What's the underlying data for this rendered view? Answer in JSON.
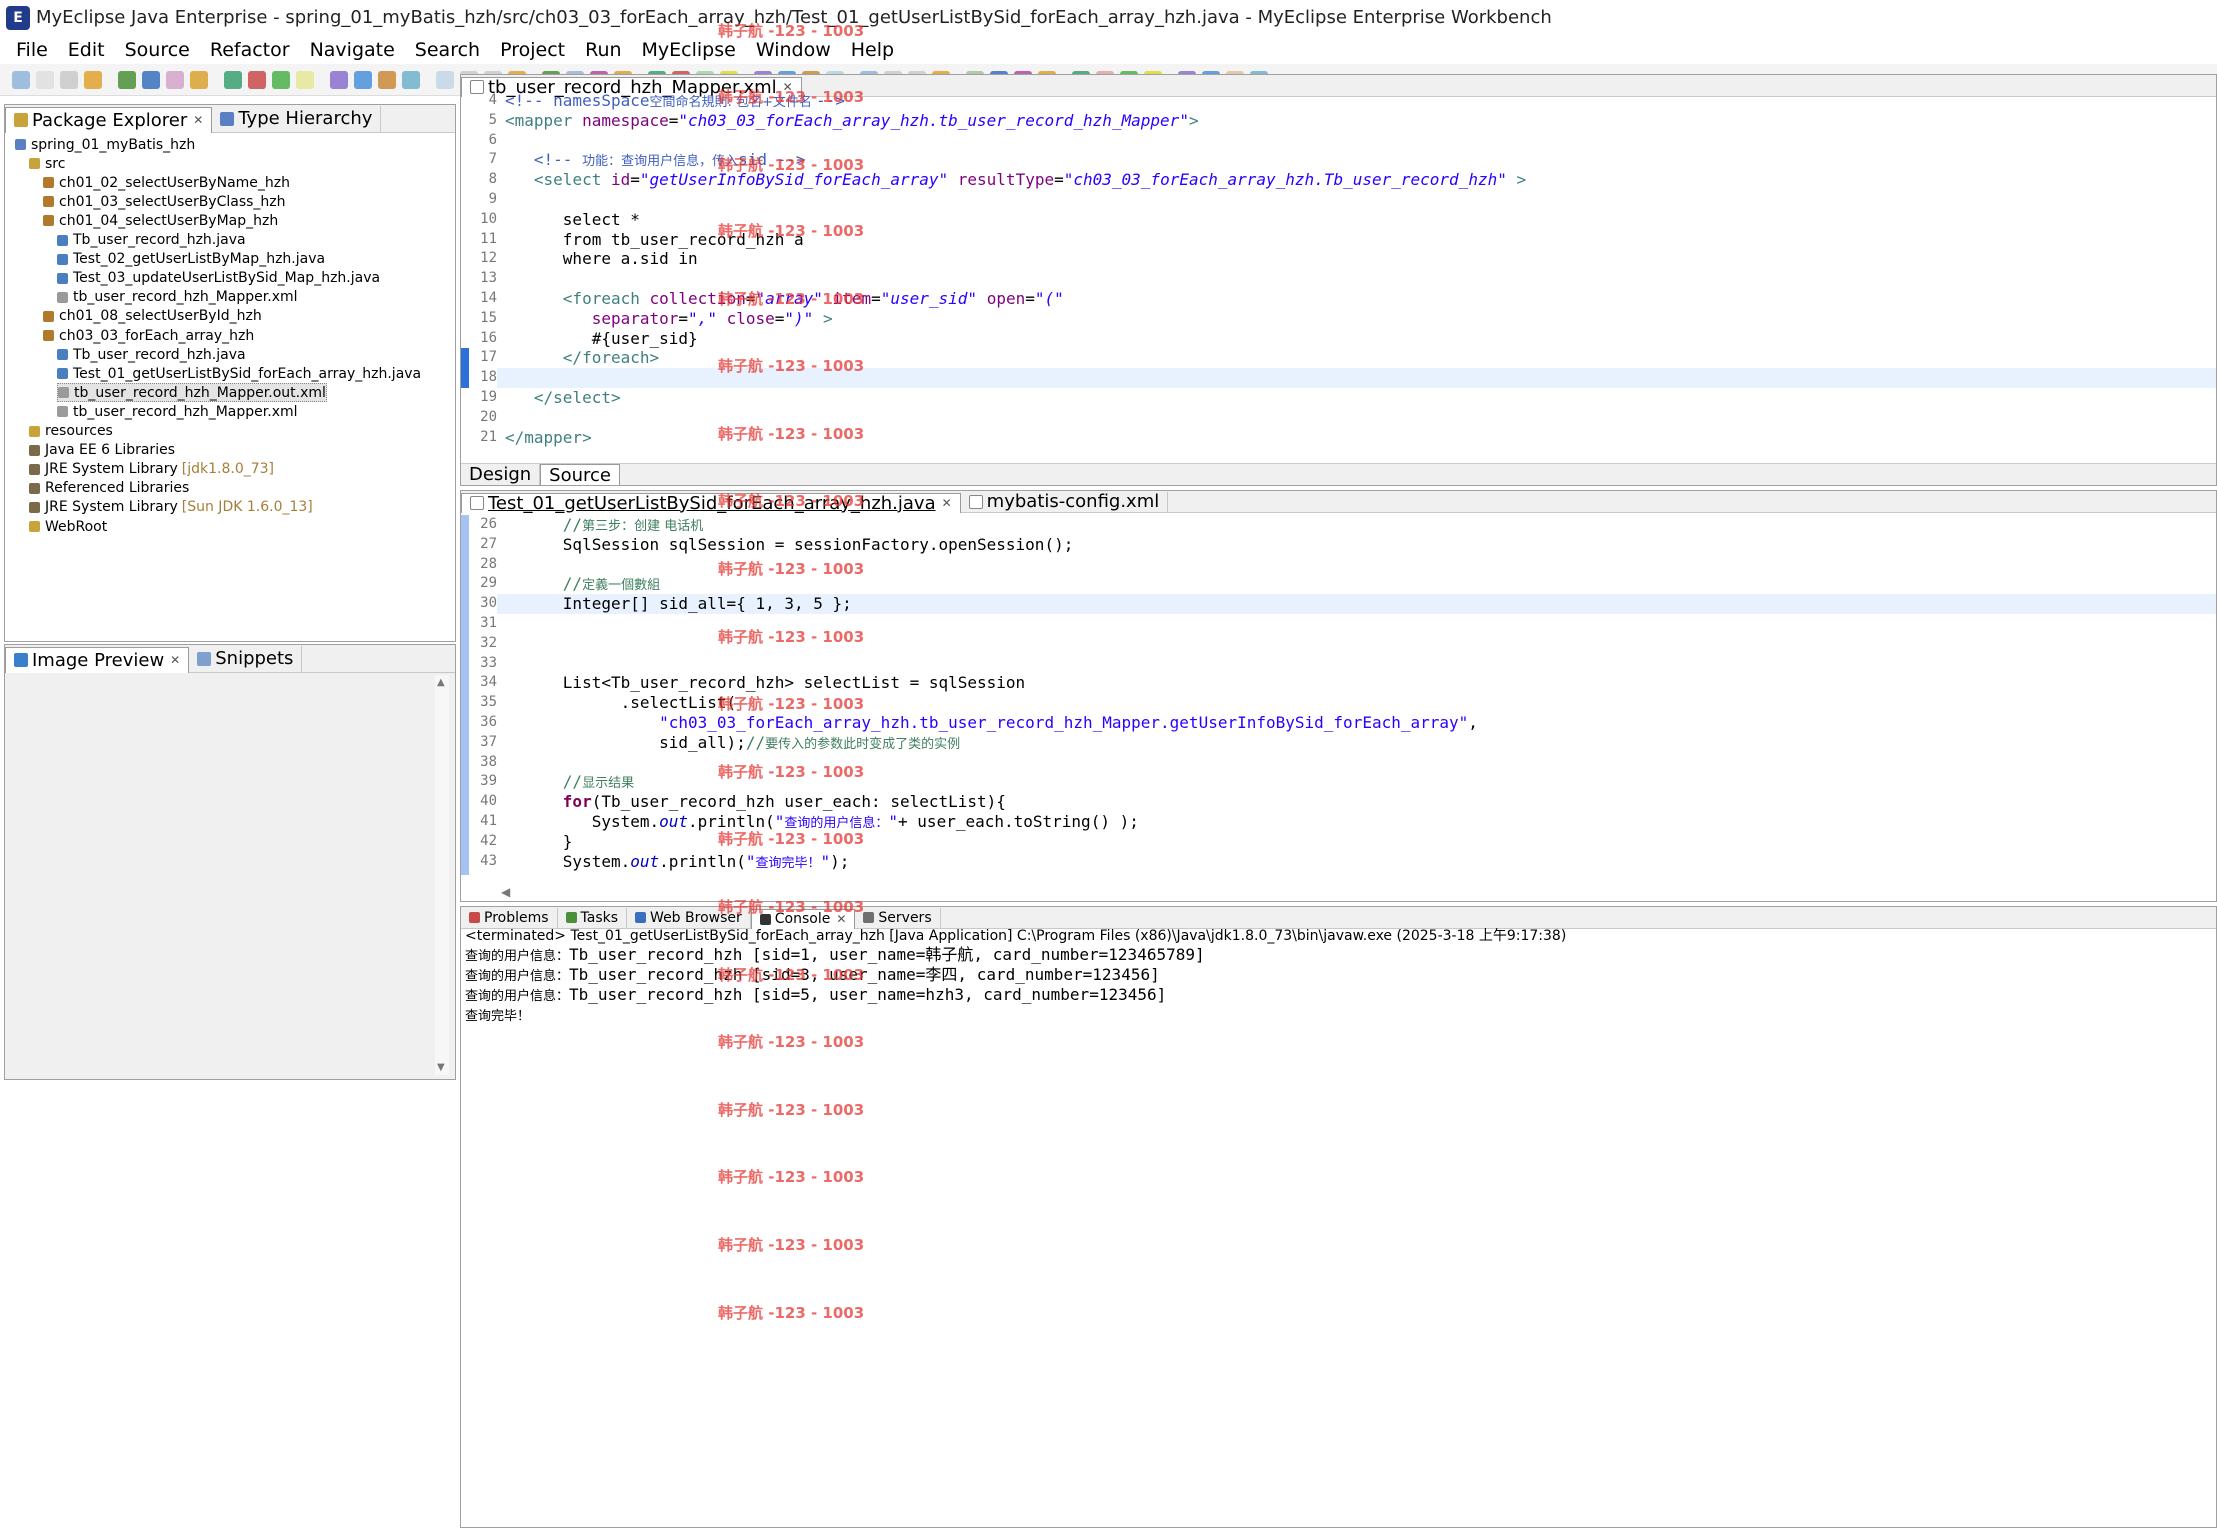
{
  "window": {
    "title": "MyEclipse Java Enterprise - spring_01_myBatis_hzh/src/ch03_03_forEach_array_hzh/Test_01_getUserListBySid_forEach_array_hzh.java - MyEclipse Enterprise Workbench"
  },
  "menu": [
    "File",
    "Edit",
    "Source",
    "Refactor",
    "Navigate",
    "Search",
    "Project",
    "Run",
    "MyEclipse",
    "Window",
    "Help"
  ],
  "package_explorer": {
    "tabs": [
      "Package Explorer",
      "Type Hierarchy"
    ],
    "items": [
      {
        "label": "spring_01_myBatis_hzh",
        "extra": ""
      },
      {
        "label": "src",
        "extra": ""
      },
      {
        "label": "ch01_02_selectUserByName_hzh",
        "extra": ""
      },
      {
        "label": "ch01_03_selectUserByClass_hzh",
        "extra": ""
      },
      {
        "label": "ch01_04_selectUserByMap_hzh",
        "extra": ""
      },
      {
        "label": "Tb_user_record_hzh.java",
        "extra": ""
      },
      {
        "label": "Test_02_getUserListByMap_hzh.java",
        "extra": ""
      },
      {
        "label": "Test_03_updateUserListBySid_Map_hzh.java",
        "extra": ""
      },
      {
        "label": "tb_user_record_hzh_Mapper.xml",
        "extra": ""
      },
      {
        "label": "ch01_08_selectUserById_hzh",
        "extra": ""
      },
      {
        "label": "ch03_03_forEach_array_hzh",
        "extra": ""
      },
      {
        "label": "Tb_user_record_hzh.java",
        "extra": ""
      },
      {
        "label": "Test_01_getUserListBySid_forEach_array_hzh.java",
        "extra": ""
      },
      {
        "label": "tb_user_record_hzh_Mapper.out.xml",
        "extra": ""
      },
      {
        "label": "tb_user_record_hzh_Mapper.xml",
        "extra": ""
      },
      {
        "label": "resources",
        "extra": ""
      },
      {
        "label": "Java EE 6 Libraries",
        "extra": ""
      },
      {
        "label": "JRE System Library",
        "extra": "[jdk1.8.0_73]"
      },
      {
        "label": "Referenced Libraries",
        "extra": ""
      },
      {
        "label": "JRE System Library",
        "extra": "[Sun JDK 1.6.0_13]"
      },
      {
        "label": "WebRoot",
        "extra": ""
      }
    ]
  },
  "image_preview": {
    "tabs": [
      "Image Preview",
      "Snippets"
    ]
  },
  "xml_editor": {
    "tab": "tb_user_record_hzh_Mapper.xml",
    "bottom_tabs": [
      "Design",
      "Source"
    ],
    "lines": [
      {
        "n": "4",
        "parts": [
          [
            "cmt",
            "<!-- namesSpace"
          ],
          [
            "cmtcn",
            "空間命名規則: 包名+文件名 "
          ],
          [
            "cmt",
            "-->"
          ]
        ]
      },
      {
        "n": "5",
        "parts": [
          [
            "tag",
            "<mapper "
          ],
          [
            "attr",
            "namespace"
          ],
          [
            "",
            "="
          ],
          [
            "str",
            "\"ch03_03_forEach_array_hzh.tb_user_record_hzh_Mapper\""
          ],
          [
            "tag",
            ">"
          ]
        ]
      },
      {
        "n": "6",
        "parts": []
      },
      {
        "n": "7",
        "parts": [
          [
            "",
            "   "
          ],
          [
            "cmt",
            "<!-- "
          ],
          [
            "cmtcn",
            "功能：查询用户信息，传入"
          ],
          [
            "cmt",
            "sid -->"
          ]
        ]
      },
      {
        "n": "8",
        "parts": [
          [
            "",
            "   "
          ],
          [
            "tag",
            "<select "
          ],
          [
            "attr",
            "id"
          ],
          [
            "",
            "="
          ],
          [
            "str",
            "\"getUserInfoBySid_forEach_array\""
          ],
          [
            "",
            " "
          ],
          [
            "attr",
            "resultType"
          ],
          [
            "",
            "="
          ],
          [
            "str",
            "\"ch03_03_forEach_array_hzh.Tb_user_record_hzh\""
          ],
          [
            "tag",
            " >"
          ]
        ]
      },
      {
        "n": "9",
        "parts": []
      },
      {
        "n": "10",
        "parts": [
          [
            "",
            "      select *"
          ]
        ]
      },
      {
        "n": "11",
        "parts": [
          [
            "",
            "      from tb_user_record_hzh a"
          ]
        ]
      },
      {
        "n": "12",
        "parts": [
          [
            "",
            "      where a.sid in"
          ]
        ]
      },
      {
        "n": "13",
        "parts": []
      },
      {
        "n": "14",
        "parts": [
          [
            "",
            "      "
          ],
          [
            "tag",
            "<foreach "
          ],
          [
            "attr",
            "collection"
          ],
          [
            "",
            "="
          ],
          [
            "str",
            "\"array\""
          ],
          [
            "",
            " "
          ],
          [
            "attr",
            "item"
          ],
          [
            "",
            "="
          ],
          [
            "str",
            "\"user_sid\""
          ],
          [
            "",
            " "
          ],
          [
            "attr",
            "open"
          ],
          [
            "",
            "="
          ],
          [
            "str",
            "\"(\""
          ]
        ]
      },
      {
        "n": "15",
        "parts": [
          [
            "",
            "         "
          ],
          [
            "attr",
            "separator"
          ],
          [
            "",
            "="
          ],
          [
            "str",
            "\",\""
          ],
          [
            "",
            " "
          ],
          [
            "attr",
            "close"
          ],
          [
            "",
            "="
          ],
          [
            "str",
            "\")\""
          ],
          [
            "tag",
            " >"
          ]
        ]
      },
      {
        "n": "16",
        "parts": [
          [
            "",
            "         #{user_sid}"
          ]
        ]
      },
      {
        "n": "17",
        "parts": [
          [
            "",
            "      "
          ],
          [
            "tag",
            "</foreach>"
          ]
        ]
      },
      {
        "n": "18",
        "parts": []
      },
      {
        "n": "19",
        "parts": [
          [
            "",
            "   "
          ],
          [
            "tag",
            "</select>"
          ]
        ]
      },
      {
        "n": "20",
        "parts": []
      },
      {
        "n": "21",
        "parts": [
          [
            "tag",
            "</mapper>"
          ]
        ]
      }
    ]
  },
  "java_editor": {
    "tabs": [
      "Test_01_getUserListBySid_forEach_array_hzh.java",
      "mybatis-config.xml"
    ],
    "lines": [
      {
        "n": "26",
        "parts": [
          [
            "",
            "      "
          ],
          [
            "jcm",
            "//"
          ],
          [
            "jcmcn",
            "第三步：创建 电话机"
          ]
        ]
      },
      {
        "n": "27",
        "parts": [
          [
            "",
            "      SqlSession sqlSession = sessionFactory.openSession();"
          ]
        ]
      },
      {
        "n": "28",
        "parts": []
      },
      {
        "n": "29",
        "parts": [
          [
            "",
            "      "
          ],
          [
            "jcm",
            "//"
          ],
          [
            "jcmcn",
            "定義一個數組"
          ]
        ]
      },
      {
        "n": "30",
        "parts": [
          [
            "",
            "      Integer[] sid_all={ 1, 3, 5 };"
          ]
        ]
      },
      {
        "n": "31",
        "parts": []
      },
      {
        "n": "32",
        "parts": []
      },
      {
        "n": "33",
        "parts": []
      },
      {
        "n": "34",
        "parts": [
          [
            "",
            "      List<Tb_user_record_hzh> selectList = sqlSession"
          ]
        ]
      },
      {
        "n": "35",
        "parts": [
          [
            "",
            "            .selectList("
          ]
        ]
      },
      {
        "n": "36",
        "parts": [
          [
            "",
            "                "
          ],
          [
            "jstr",
            "\"ch03_03_forEach_array_hzh.tb_user_record_hzh_Mapper.getUserInfoBySid_forEach_array\""
          ],
          [
            "",
            ","
          ]
        ]
      },
      {
        "n": "37",
        "parts": [
          [
            "",
            "                sid_all);"
          ],
          [
            "jcm",
            "//"
          ],
          [
            "jcmcn",
            "要传入的参数此时变成了类的实例"
          ]
        ]
      },
      {
        "n": "38",
        "parts": []
      },
      {
        "n": "39",
        "parts": [
          [
            "",
            "      "
          ],
          [
            "jcm",
            "//"
          ],
          [
            "jcmcn",
            "显示结果"
          ]
        ]
      },
      {
        "n": "40",
        "parts": [
          [
            "",
            "      "
          ],
          [
            "kw",
            "for"
          ],
          [
            "",
            "(Tb_user_record_hzh user_each: selectList){"
          ]
        ]
      },
      {
        "n": "41",
        "parts": [
          [
            "",
            "         System."
          ],
          [
            "fld",
            "out"
          ],
          [
            "",
            ".println("
          ],
          [
            "jstr",
            "\""
          ],
          [
            "jstrcn",
            "查询的用户信息："
          ],
          [
            "jstr",
            "\""
          ],
          [
            "",
            "+ user_each.toString() );"
          ]
        ]
      },
      {
        "n": "42",
        "parts": [
          [
            "",
            "      }"
          ]
        ]
      },
      {
        "n": "43",
        "parts": [
          [
            "",
            "      System."
          ],
          [
            "fld",
            "out"
          ],
          [
            "",
            ".println("
          ],
          [
            "jstr",
            "\""
          ],
          [
            "jstrcn",
            "查询完毕！"
          ],
          [
            "jstr",
            "\""
          ],
          [
            "",
            ");"
          ]
        ]
      }
    ]
  },
  "bottom": {
    "tabs": [
      "Problems",
      "Tasks",
      "Web Browser",
      "Console",
      "Servers"
    ],
    "status": "<terminated> Test_01_getUserListBySid_forEach_array_hzh [Java Application] C:\\Program Files (x86)\\Java\\jdk1.8.0_73\\bin\\javaw.exe (2025-3-18 上午9:17:38)",
    "output": [
      {
        "cn": "查询的用户信息：",
        "text": "Tb_user_record_hzh [sid=1, user_name=韩子航, card_number=123465789]"
      },
      {
        "cn": "查询的用户信息：",
        "text": "Tb_user_record_hzh [sid=3, user_name=李四, card_number=123456]"
      },
      {
        "cn": "查询的用户信息：",
        "text": "Tb_user_record_hzh [sid=5, user_name=hzh3, card_number=123456]"
      },
      {
        "cn": "查询完毕！",
        "text": ""
      }
    ]
  },
  "watermark": "韩子航 -123 - 1003"
}
